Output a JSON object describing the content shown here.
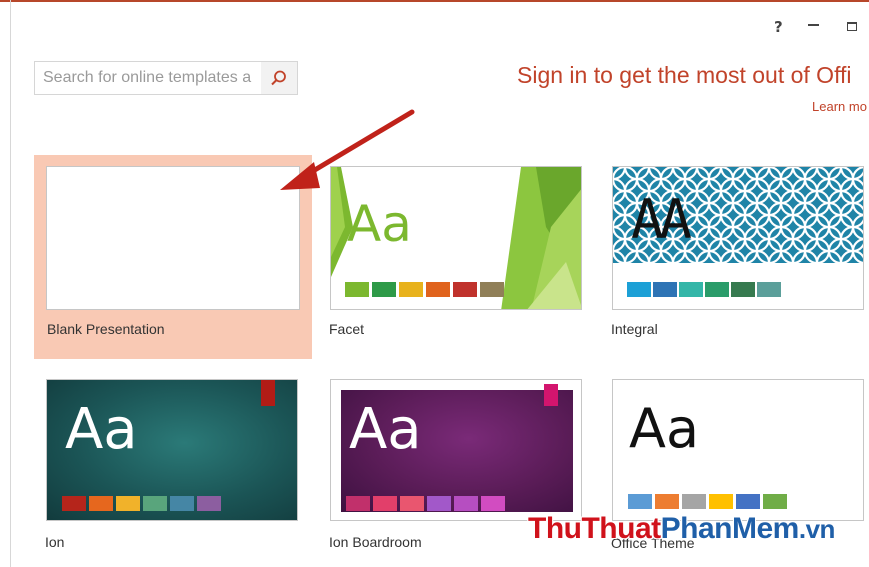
{
  "window": {
    "help_label": "?",
    "minimize_label": "–",
    "maximize_label": "□"
  },
  "search": {
    "placeholder": "Search for online templates a",
    "icon": "search-icon"
  },
  "signin": {
    "text": "Sign in to get the most out of Offi",
    "learn_more": "Learn mo"
  },
  "templates": [
    {
      "name": "Blank Presentation",
      "selected": true
    },
    {
      "name": "Facet",
      "aa": "Aa",
      "aa_color": "#7cb82f",
      "swatches": [
        "#7cb82f",
        "#2e9a48",
        "#e8b21c",
        "#e0631d",
        "#c0322c",
        "#907f58"
      ]
    },
    {
      "name": "Integral",
      "aa": "AA",
      "aa_color": "#111111",
      "bg_color": "#1f84a7",
      "swatches": [
        "#1ca0d6",
        "#2e74b5",
        "#34b6a8",
        "#2a9c6a",
        "#367a4f",
        "#5b9f9a"
      ]
    },
    {
      "name": "Ion",
      "aa": "Aa",
      "aa_color": "#ffffff",
      "bg_color": "#1d5a5b",
      "accent": "#b11c16",
      "swatches": [
        "#b5251b",
        "#e6671e",
        "#f1b22a",
        "#59a57c",
        "#4586a5",
        "#8c5ea0"
      ]
    },
    {
      "name": "Ion Boardroom",
      "aa": "Aa",
      "aa_color": "#ffffff",
      "bg_color": "#5c1c58",
      "accent": "#d3156e",
      "swatches": [
        "#c1306b",
        "#e23f6a",
        "#e9566f",
        "#a258c9",
        "#b64ec1",
        "#d24cc1"
      ]
    },
    {
      "name": "Office Theme",
      "aa": "Aa",
      "aa_color": "#111111",
      "swatches": [
        "#5b9bd5",
        "#ed7d31",
        "#a5a5a5",
        "#ffc000",
        "#4472c4",
        "#70ad47"
      ]
    }
  ],
  "watermark": {
    "part1": "ThuThuat",
    "part2": "PhanMem",
    "part3": ".vn"
  },
  "colors": {
    "accent": "#c1432a",
    "selected_bg": "#f9c9b4",
    "arrow": "#c0221a"
  }
}
